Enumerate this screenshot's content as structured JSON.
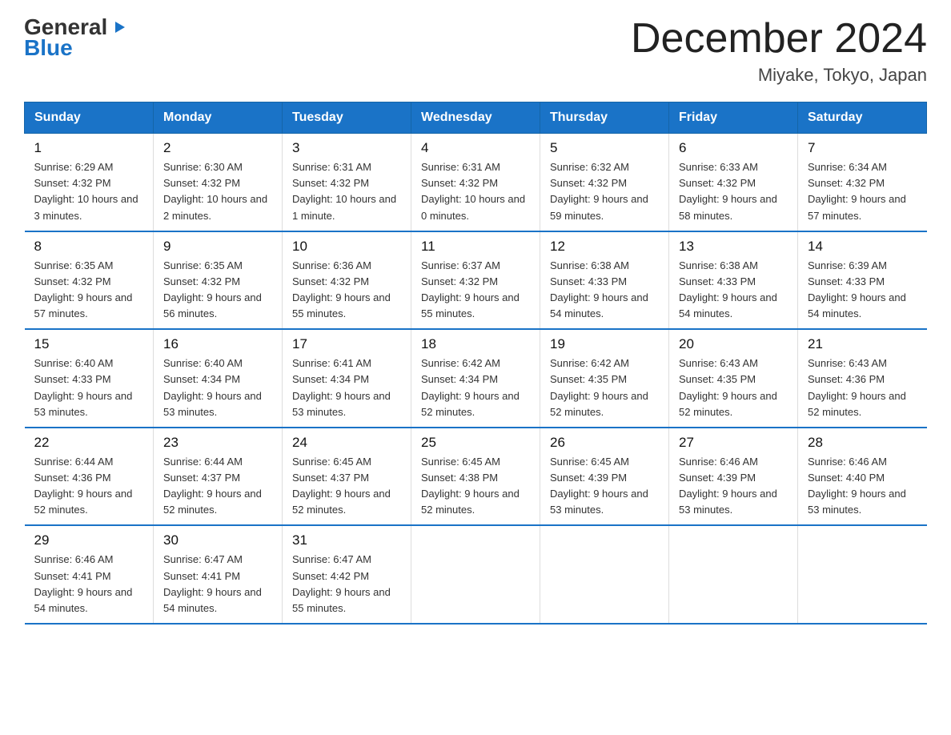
{
  "header": {
    "logo_line1": "General",
    "logo_line2": "Blue",
    "title": "December 2024",
    "subtitle": "Miyake, Tokyo, Japan"
  },
  "weekdays": [
    "Sunday",
    "Monday",
    "Tuesday",
    "Wednesday",
    "Thursday",
    "Friday",
    "Saturday"
  ],
  "weeks": [
    [
      {
        "day": "1",
        "sunrise": "6:29 AM",
        "sunset": "4:32 PM",
        "daylight": "10 hours and 3 minutes."
      },
      {
        "day": "2",
        "sunrise": "6:30 AM",
        "sunset": "4:32 PM",
        "daylight": "10 hours and 2 minutes."
      },
      {
        "day": "3",
        "sunrise": "6:31 AM",
        "sunset": "4:32 PM",
        "daylight": "10 hours and 1 minute."
      },
      {
        "day": "4",
        "sunrise": "6:31 AM",
        "sunset": "4:32 PM",
        "daylight": "10 hours and 0 minutes."
      },
      {
        "day": "5",
        "sunrise": "6:32 AM",
        "sunset": "4:32 PM",
        "daylight": "9 hours and 59 minutes."
      },
      {
        "day": "6",
        "sunrise": "6:33 AM",
        "sunset": "4:32 PM",
        "daylight": "9 hours and 58 minutes."
      },
      {
        "day": "7",
        "sunrise": "6:34 AM",
        "sunset": "4:32 PM",
        "daylight": "9 hours and 57 minutes."
      }
    ],
    [
      {
        "day": "8",
        "sunrise": "6:35 AM",
        "sunset": "4:32 PM",
        "daylight": "9 hours and 57 minutes."
      },
      {
        "day": "9",
        "sunrise": "6:35 AM",
        "sunset": "4:32 PM",
        "daylight": "9 hours and 56 minutes."
      },
      {
        "day": "10",
        "sunrise": "6:36 AM",
        "sunset": "4:32 PM",
        "daylight": "9 hours and 55 minutes."
      },
      {
        "day": "11",
        "sunrise": "6:37 AM",
        "sunset": "4:32 PM",
        "daylight": "9 hours and 55 minutes."
      },
      {
        "day": "12",
        "sunrise": "6:38 AM",
        "sunset": "4:33 PM",
        "daylight": "9 hours and 54 minutes."
      },
      {
        "day": "13",
        "sunrise": "6:38 AM",
        "sunset": "4:33 PM",
        "daylight": "9 hours and 54 minutes."
      },
      {
        "day": "14",
        "sunrise": "6:39 AM",
        "sunset": "4:33 PM",
        "daylight": "9 hours and 54 minutes."
      }
    ],
    [
      {
        "day": "15",
        "sunrise": "6:40 AM",
        "sunset": "4:33 PM",
        "daylight": "9 hours and 53 minutes."
      },
      {
        "day": "16",
        "sunrise": "6:40 AM",
        "sunset": "4:34 PM",
        "daylight": "9 hours and 53 minutes."
      },
      {
        "day": "17",
        "sunrise": "6:41 AM",
        "sunset": "4:34 PM",
        "daylight": "9 hours and 53 minutes."
      },
      {
        "day": "18",
        "sunrise": "6:42 AM",
        "sunset": "4:34 PM",
        "daylight": "9 hours and 52 minutes."
      },
      {
        "day": "19",
        "sunrise": "6:42 AM",
        "sunset": "4:35 PM",
        "daylight": "9 hours and 52 minutes."
      },
      {
        "day": "20",
        "sunrise": "6:43 AM",
        "sunset": "4:35 PM",
        "daylight": "9 hours and 52 minutes."
      },
      {
        "day": "21",
        "sunrise": "6:43 AM",
        "sunset": "4:36 PM",
        "daylight": "9 hours and 52 minutes."
      }
    ],
    [
      {
        "day": "22",
        "sunrise": "6:44 AM",
        "sunset": "4:36 PM",
        "daylight": "9 hours and 52 minutes."
      },
      {
        "day": "23",
        "sunrise": "6:44 AM",
        "sunset": "4:37 PM",
        "daylight": "9 hours and 52 minutes."
      },
      {
        "day": "24",
        "sunrise": "6:45 AM",
        "sunset": "4:37 PM",
        "daylight": "9 hours and 52 minutes."
      },
      {
        "day": "25",
        "sunrise": "6:45 AM",
        "sunset": "4:38 PM",
        "daylight": "9 hours and 52 minutes."
      },
      {
        "day": "26",
        "sunrise": "6:45 AM",
        "sunset": "4:39 PM",
        "daylight": "9 hours and 53 minutes."
      },
      {
        "day": "27",
        "sunrise": "6:46 AM",
        "sunset": "4:39 PM",
        "daylight": "9 hours and 53 minutes."
      },
      {
        "day": "28",
        "sunrise": "6:46 AM",
        "sunset": "4:40 PM",
        "daylight": "9 hours and 53 minutes."
      }
    ],
    [
      {
        "day": "29",
        "sunrise": "6:46 AM",
        "sunset": "4:41 PM",
        "daylight": "9 hours and 54 minutes."
      },
      {
        "day": "30",
        "sunrise": "6:47 AM",
        "sunset": "4:41 PM",
        "daylight": "9 hours and 54 minutes."
      },
      {
        "day": "31",
        "sunrise": "6:47 AM",
        "sunset": "4:42 PM",
        "daylight": "9 hours and 55 minutes."
      },
      null,
      null,
      null,
      null
    ]
  ]
}
